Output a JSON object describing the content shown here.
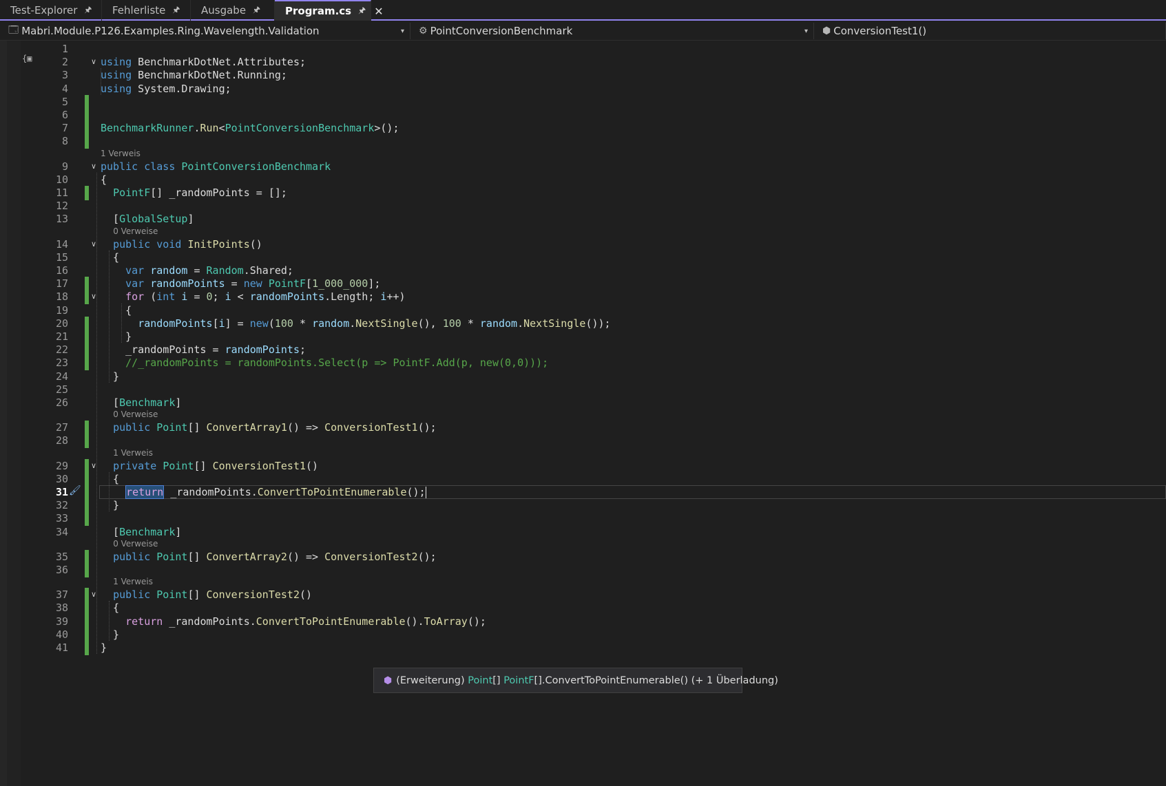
{
  "tabs": [
    {
      "label": "Test-Explorer",
      "pinned": true,
      "active": false
    },
    {
      "label": "Fehlerliste",
      "pinned": true,
      "active": false
    },
    {
      "label": "Ausgabe",
      "pinned": true,
      "active": false
    },
    {
      "label": "Program.cs",
      "pinned": true,
      "active": true
    }
  ],
  "navbar": {
    "project": "Mabri.Module.P126.Examples.Ring.Wavelength.Validation",
    "type": "PointConversionBenchmark",
    "member": "ConversionTest1()"
  },
  "icons": {
    "pin": "pin-icon",
    "close": "close-icon",
    "project": "project-icon",
    "class": "class-icon",
    "method": "method-icon",
    "fold": "chevron-down-icon",
    "quick_action": "paintbrush-icon",
    "extension": "extension-method-icon"
  },
  "colors": {
    "accent": "#9184ee",
    "keyword": "#569cd6",
    "control": "#d8a0df",
    "type": "#4ec9b0",
    "method": "#dcdcaa",
    "variable": "#9cdcfe",
    "number": "#b5cea8",
    "comment": "#57a64a",
    "change_bar": "#57a64a"
  },
  "editor": {
    "current_line": 31,
    "code_lens": [
      {
        "before_line": 9,
        "text": "1 Verweis"
      },
      {
        "before_line": 14,
        "text": "0 Verweise"
      },
      {
        "before_line": 27,
        "text": "0 Verweise"
      },
      {
        "before_line": 29,
        "text": "1 Verweis"
      },
      {
        "before_line": 35,
        "text": "0 Verweise"
      },
      {
        "before_line": 37,
        "text": "1 Verweis"
      }
    ],
    "lines": [
      {
        "n": 1,
        "tokens": []
      },
      {
        "n": 2,
        "fold": true,
        "tokens": [
          [
            "kw",
            "using"
          ],
          [
            "plain",
            " BenchmarkDotNet.Attributes;"
          ]
        ]
      },
      {
        "n": 3,
        "tokens": [
          [
            "kw",
            "using"
          ],
          [
            "plain",
            " BenchmarkDotNet.Running;"
          ]
        ]
      },
      {
        "n": 4,
        "tokens": [
          [
            "kw",
            "using"
          ],
          [
            "plain",
            " System.Drawing;"
          ]
        ]
      },
      {
        "n": 5,
        "changed": true,
        "tokens": []
      },
      {
        "n": 6,
        "changed": true,
        "tokens": []
      },
      {
        "n": 7,
        "changed": true,
        "tokens": [
          [
            "typ",
            "BenchmarkRunner"
          ],
          [
            "plain",
            "."
          ],
          [
            "mth",
            "Run"
          ],
          [
            "plain",
            "<"
          ],
          [
            "typ",
            "PointConversionBenchmark"
          ],
          [
            "plain",
            ">();"
          ]
        ]
      },
      {
        "n": 8,
        "changed": true,
        "tokens": []
      },
      {
        "n": 9,
        "fold": true,
        "tokens": [
          [
            "kw",
            "public"
          ],
          [
            "plain",
            " "
          ],
          [
            "kw",
            "class"
          ],
          [
            "plain",
            " "
          ],
          [
            "typ",
            "PointConversionBenchmark"
          ]
        ]
      },
      {
        "n": 10,
        "tokens": [
          [
            "plain",
            "{"
          ]
        ]
      },
      {
        "n": 11,
        "changed": true,
        "tokens": [
          [
            "plain",
            "  "
          ],
          [
            "typ",
            "PointF"
          ],
          [
            "plain",
            "[] _randomPoints = [];"
          ]
        ]
      },
      {
        "n": 12,
        "tokens": []
      },
      {
        "n": 13,
        "tokens": [
          [
            "plain",
            "  ["
          ],
          [
            "typ",
            "GlobalSetup"
          ],
          [
            "plain",
            "]"
          ]
        ]
      },
      {
        "n": 14,
        "fold": true,
        "tokens": [
          [
            "plain",
            "  "
          ],
          [
            "kw",
            "public"
          ],
          [
            "plain",
            " "
          ],
          [
            "kw",
            "void"
          ],
          [
            "plain",
            " "
          ],
          [
            "mth",
            "InitPoints"
          ],
          [
            "plain",
            "()"
          ]
        ]
      },
      {
        "n": 15,
        "tokens": [
          [
            "plain",
            "  {"
          ]
        ]
      },
      {
        "n": 16,
        "tokens": [
          [
            "plain",
            "    "
          ],
          [
            "kw",
            "var"
          ],
          [
            "plain",
            " "
          ],
          [
            "var",
            "random"
          ],
          [
            "plain",
            " = "
          ],
          [
            "typ",
            "Random"
          ],
          [
            "plain",
            ".Shared;"
          ]
        ]
      },
      {
        "n": 17,
        "changed": true,
        "tokens": [
          [
            "plain",
            "    "
          ],
          [
            "kw",
            "var"
          ],
          [
            "plain",
            " "
          ],
          [
            "var",
            "randomPoints"
          ],
          [
            "plain",
            " = "
          ],
          [
            "kw",
            "new"
          ],
          [
            "plain",
            " "
          ],
          [
            "typ",
            "PointF"
          ],
          [
            "plain",
            "["
          ],
          [
            "num",
            "1_000_000"
          ],
          [
            "plain",
            "];"
          ]
        ]
      },
      {
        "n": 18,
        "changed": true,
        "fold": true,
        "tokens": [
          [
            "plain",
            "    "
          ],
          [
            "ctl",
            "for"
          ],
          [
            "plain",
            " ("
          ],
          [
            "kw",
            "int"
          ],
          [
            "plain",
            " "
          ],
          [
            "var",
            "i"
          ],
          [
            "plain",
            " = "
          ],
          [
            "num",
            "0"
          ],
          [
            "plain",
            "; "
          ],
          [
            "var",
            "i"
          ],
          [
            "plain",
            " < "
          ],
          [
            "var",
            "randomPoints"
          ],
          [
            "plain",
            ".Length; "
          ],
          [
            "var",
            "i"
          ],
          [
            "plain",
            "++)"
          ]
        ]
      },
      {
        "n": 19,
        "tokens": [
          [
            "plain",
            "    {"
          ]
        ]
      },
      {
        "n": 20,
        "changed": true,
        "tokens": [
          [
            "plain",
            "      "
          ],
          [
            "var",
            "randomPoints"
          ],
          [
            "plain",
            "["
          ],
          [
            "var",
            "i"
          ],
          [
            "plain",
            "] = "
          ],
          [
            "kw",
            "new"
          ],
          [
            "plain",
            "("
          ],
          [
            "num",
            "100"
          ],
          [
            "plain",
            " * "
          ],
          [
            "var",
            "random"
          ],
          [
            "plain",
            "."
          ],
          [
            "mth",
            "NextSingle"
          ],
          [
            "plain",
            "(), "
          ],
          [
            "num",
            "100"
          ],
          [
            "plain",
            " * "
          ],
          [
            "var",
            "random"
          ],
          [
            "plain",
            "."
          ],
          [
            "mth",
            "NextSingle"
          ],
          [
            "plain",
            "());"
          ]
        ]
      },
      {
        "n": 21,
        "changed": true,
        "tokens": [
          [
            "plain",
            "    }"
          ]
        ]
      },
      {
        "n": 22,
        "changed": true,
        "tokens": [
          [
            "plain",
            "    _randomPoints = "
          ],
          [
            "var",
            "randomPoints"
          ],
          [
            "plain",
            ";"
          ]
        ]
      },
      {
        "n": 23,
        "changed": true,
        "tokens": [
          [
            "plain",
            "    "
          ],
          [
            "cmt",
            "//_randomPoints = randomPoints.Select(p => PointF.Add(p, new(0,0)));"
          ]
        ]
      },
      {
        "n": 24,
        "tokens": [
          [
            "plain",
            "  }"
          ]
        ]
      },
      {
        "n": 25,
        "tokens": []
      },
      {
        "n": 26,
        "tokens": [
          [
            "plain",
            "  ["
          ],
          [
            "typ",
            "Benchmark"
          ],
          [
            "plain",
            "]"
          ]
        ]
      },
      {
        "n": 27,
        "changed": true,
        "tokens": [
          [
            "plain",
            "  "
          ],
          [
            "kw",
            "public"
          ],
          [
            "plain",
            " "
          ],
          [
            "typ",
            "Point"
          ],
          [
            "plain",
            "[] "
          ],
          [
            "mth",
            "ConvertArray1"
          ],
          [
            "plain",
            "() => "
          ],
          [
            "mth",
            "ConversionTest1"
          ],
          [
            "plain",
            "();"
          ]
        ]
      },
      {
        "n": 28,
        "changed": true,
        "tokens": []
      },
      {
        "n": 29,
        "changed": true,
        "fold": true,
        "tokens": [
          [
            "plain",
            "  "
          ],
          [
            "kw",
            "private"
          ],
          [
            "plain",
            " "
          ],
          [
            "typ",
            "Point"
          ],
          [
            "plain",
            "[] "
          ],
          [
            "mth",
            "ConversionTest1"
          ],
          [
            "plain",
            "()"
          ]
        ]
      },
      {
        "n": 30,
        "changed": true,
        "tokens": [
          [
            "plain",
            "  {"
          ]
        ]
      },
      {
        "n": 31,
        "changed": true,
        "current": true,
        "tokens": [
          [
            "plain",
            "    "
          ],
          [
            "ctl-hl",
            "return"
          ],
          [
            "plain",
            " _randomPoints."
          ],
          [
            "mth",
            "ConvertToPointEnumerable"
          ],
          [
            "plain",
            "();"
          ],
          [
            "caret",
            ""
          ]
        ]
      },
      {
        "n": 32,
        "changed": true,
        "tokens": [
          [
            "plain",
            "  }"
          ]
        ]
      },
      {
        "n": 33,
        "changed": true,
        "tokens": []
      },
      {
        "n": 34,
        "tokens": [
          [
            "plain",
            "  ["
          ],
          [
            "typ",
            "Benchmark"
          ],
          [
            "plain",
            "]"
          ]
        ]
      },
      {
        "n": 35,
        "changed": true,
        "tokens": [
          [
            "plain",
            "  "
          ],
          [
            "kw",
            "public"
          ],
          [
            "plain",
            " "
          ],
          [
            "typ",
            "Point"
          ],
          [
            "plain",
            "[] "
          ],
          [
            "mth",
            "ConvertArray2"
          ],
          [
            "plain",
            "() => "
          ],
          [
            "mth",
            "ConversionTest2"
          ],
          [
            "plain",
            "();"
          ]
        ]
      },
      {
        "n": 36,
        "changed": true,
        "tokens": []
      },
      {
        "n": 37,
        "changed": true,
        "fold": true,
        "tokens": [
          [
            "plain",
            "  "
          ],
          [
            "kw",
            "public"
          ],
          [
            "plain",
            " "
          ],
          [
            "typ",
            "Point"
          ],
          [
            "plain",
            "[] "
          ],
          [
            "mth",
            "ConversionTest2"
          ],
          [
            "plain",
            "()"
          ]
        ]
      },
      {
        "n": 38,
        "changed": true,
        "tokens": [
          [
            "plain",
            "  {"
          ]
        ]
      },
      {
        "n": 39,
        "changed": true,
        "tokens": [
          [
            "plain",
            "    "
          ],
          [
            "ctl",
            "return"
          ],
          [
            "plain",
            " _randomPoints."
          ],
          [
            "mth",
            "ConvertToPointEnumerable"
          ],
          [
            "plain",
            "()."
          ],
          [
            "mth",
            "ToArray"
          ],
          [
            "plain",
            "();"
          ]
        ]
      },
      {
        "n": 40,
        "changed": true,
        "tokens": [
          [
            "plain",
            "  }"
          ]
        ]
      },
      {
        "n": 41,
        "changed": true,
        "tokens": [
          [
            "plain",
            "}"
          ]
        ]
      }
    ]
  },
  "tooltip": {
    "prefix": "(Erweiterung)",
    "return_type": "Point",
    "return_suffix": "[]",
    "receiver_type": "PointF",
    "rest": "[].ConvertToPointEnumerable() (+ 1 Überladung)"
  }
}
